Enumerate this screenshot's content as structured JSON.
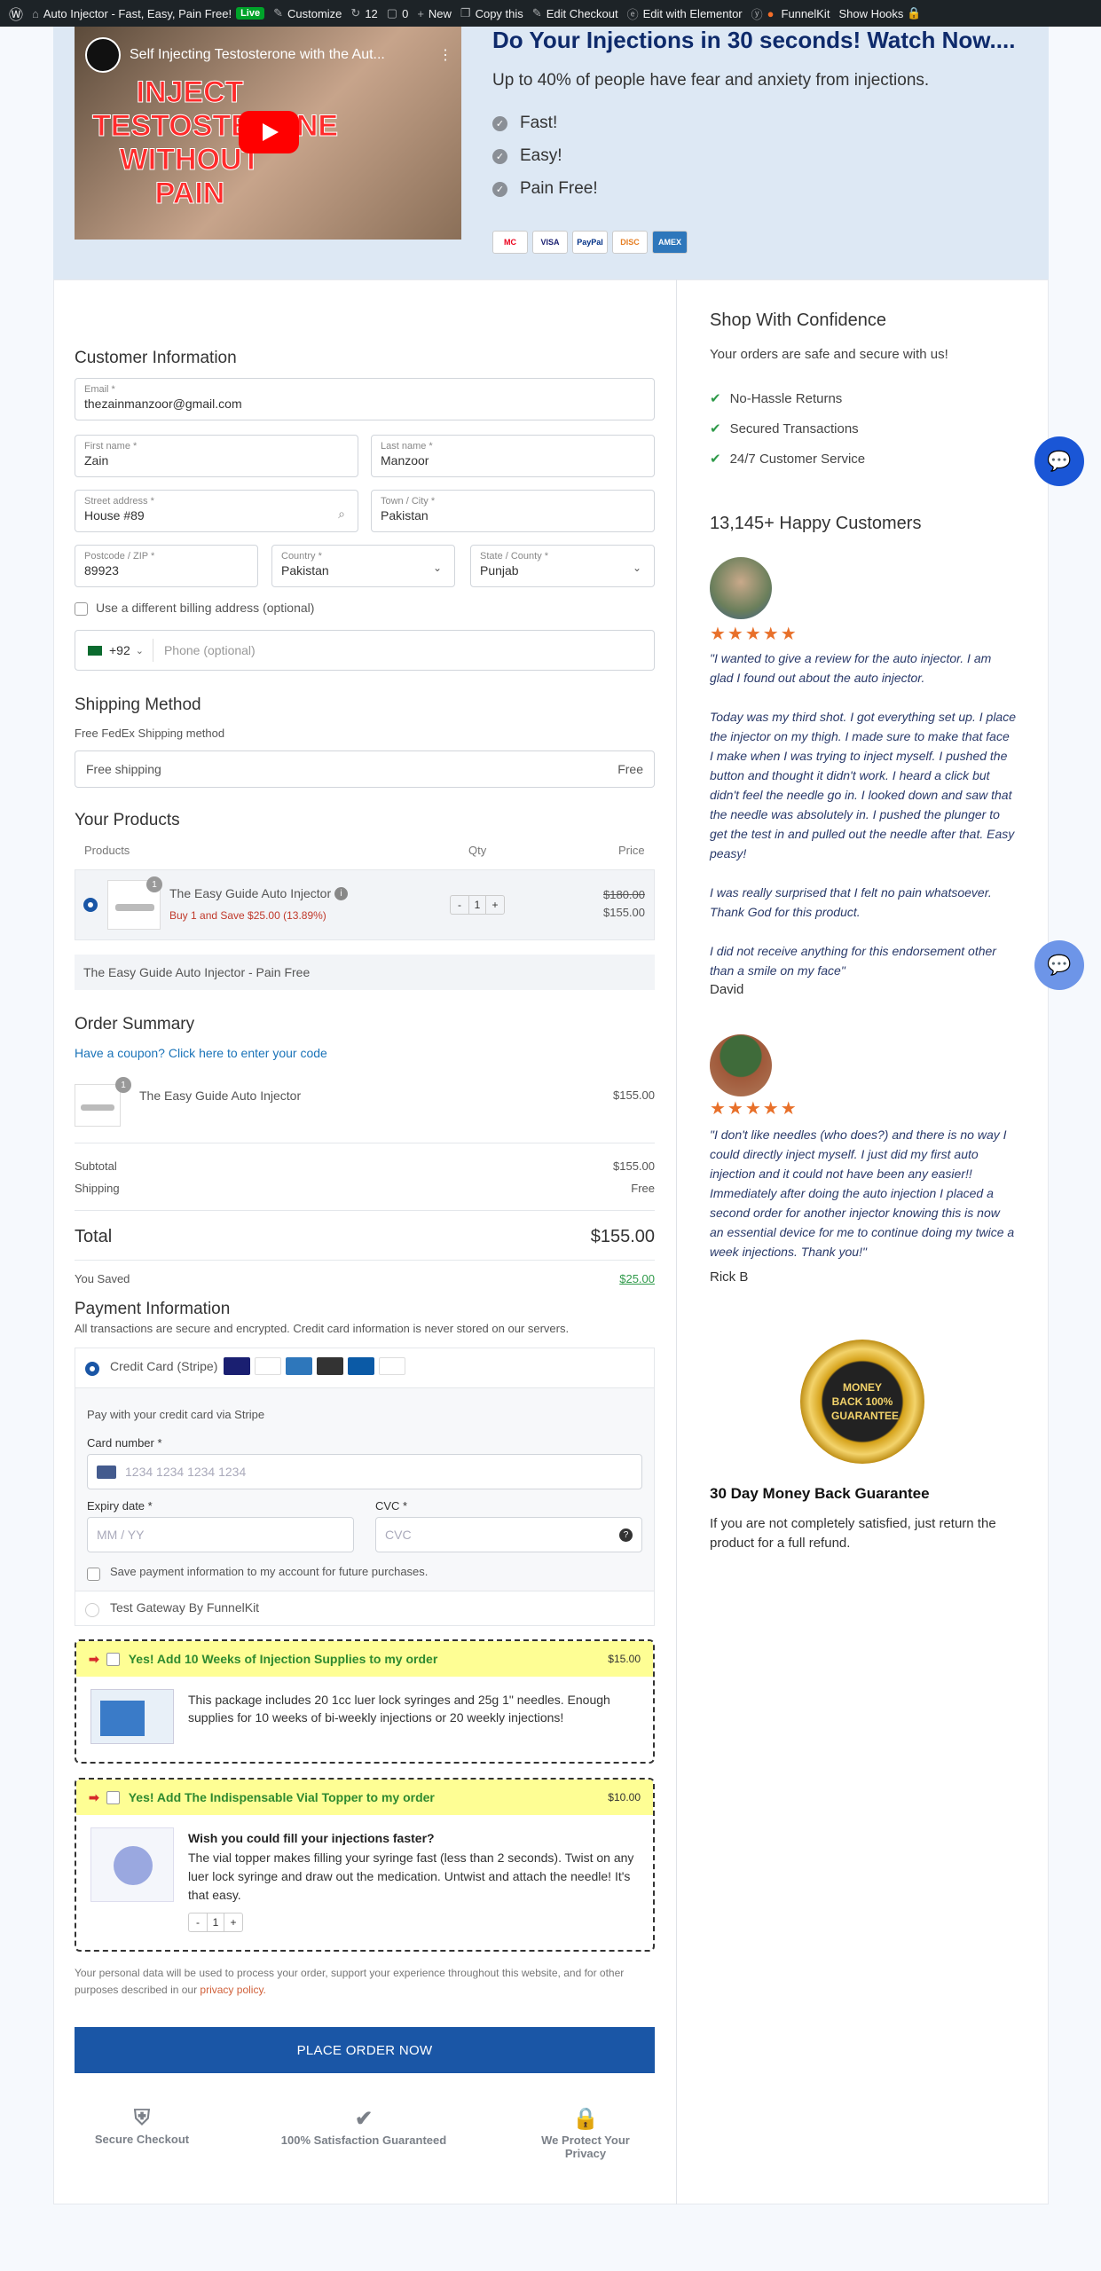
{
  "admin_bar": {
    "site": "Auto Injector - Fast, Easy, Pain Free!",
    "live": "Live",
    "customize": "Customize",
    "updates": "12",
    "comments": "0",
    "new": "New",
    "copy": "Copy this",
    "edit_checkout": "Edit Checkout",
    "elementor": "Edit with Elementor",
    "funnelkit": "FunnelKit",
    "show_hooks": "Show Hooks"
  },
  "hero": {
    "video_title": "Self Injecting Testosterone with the Aut...",
    "video_text": "INJECT TESTOSTERONE WITHOUT PAIN",
    "headline": "Do Your Injections in 30 seconds! Watch Now....",
    "subtitle": "Up to 40% of people have fear and anxiety from injections.",
    "benefits": [
      "Fast!",
      "Easy!",
      "Pain Free!"
    ],
    "cards": [
      "MC",
      "VISA",
      "PayPal",
      "DISC",
      "AMEX"
    ]
  },
  "customer": {
    "title": "Customer Information",
    "email_label": "Email *",
    "email": "thezainmanzoor@gmail.com",
    "first_label": "First name *",
    "first": "Zain",
    "last_label": "Last name *",
    "last": "Manzoor",
    "street_label": "Street address *",
    "street": "House #89",
    "city_label": "Town / City *",
    "city": "Pakistan",
    "zip_label": "Postcode / ZIP *",
    "zip": "89923",
    "country_label": "Country *",
    "country": "Pakistan",
    "state_label": "State / County *",
    "state": "Punjab",
    "billing_label": "Use a different billing address (optional)",
    "phone_code": "+92",
    "phone_placeholder": "Phone (optional)"
  },
  "shipping": {
    "title": "Shipping Method",
    "subtitle": "Free FedEx Shipping method",
    "option": "Free shipping",
    "price": "Free"
  },
  "products": {
    "title": "Your Products",
    "col_products": "Products",
    "col_qty": "Qty",
    "col_price": "Price",
    "name": "The Easy Guide Auto Injector",
    "badge": "1",
    "offer": "Buy 1 and Save $25.00 (13.89%)",
    "qty": "1",
    "old_price": "$180.00",
    "price": "$155.00",
    "description": "The Easy Guide Auto Injector - Pain Free"
  },
  "summary": {
    "title": "Order Summary",
    "coupon": "Have a coupon? Click here to enter your code",
    "item": "The Easy Guide Auto Injector",
    "item_price": "$155.00",
    "badge": "1",
    "subtotal_label": "Subtotal",
    "subtotal": "$155.00",
    "shipping_label": "Shipping",
    "shipping": "Free",
    "total_label": "Total",
    "total": "$155.00",
    "saved_label": "You Saved",
    "saved": "$25.00"
  },
  "payment": {
    "title": "Payment Information",
    "note": "All transactions are secure and encrypted. Credit card information is never stored on our servers.",
    "stripe_label": "Credit Card (Stripe)",
    "stripe_desc": "Pay with your credit card via Stripe",
    "card_label": "Card number *",
    "card_placeholder": "1234 1234 1234 1234",
    "exp_label": "Expiry date *",
    "exp_placeholder": "MM / YY",
    "cvc_label": "CVC *",
    "cvc_placeholder": "CVC",
    "save_label": "Save payment information to my account for future purchases.",
    "test_gateway": "Test Gateway By FunnelKit"
  },
  "upsells": [
    {
      "title": "Yes! Add 10 Weeks of Injection Supplies to my order",
      "price": "$15.00",
      "desc": "This package includes 20 1cc luer lock syringes and 25g 1\" needles. Enough supplies for 10 weeks of bi-weekly injections or 20 weekly injections!"
    },
    {
      "title": "Yes! Add The Indispensable Vial Topper to my order",
      "price": "$10.00",
      "heading": "Wish you could fill your injections faster?",
      "desc": "The vial topper makes filling your syringe fast (less than 2 seconds). Twist on any luer lock syringe and draw out the medication. Untwist and attach the needle! It's that easy.",
      "qty": "1"
    }
  ],
  "privacy": {
    "text": "Your personal data will be used to process your order, support your experience throughout this website, and for other purposes described in our ",
    "link": "privacy policy."
  },
  "place_order": "PLACE ORDER NOW",
  "trust": [
    "Secure Checkout",
    "100% Satisfaction Guaranteed",
    "We Protect Your Privacy"
  ],
  "sidebar": {
    "confidence_title": "Shop With Confidence",
    "confidence_sub": "Your orders are safe and secure with us!",
    "points": [
      "No-Hassle Returns",
      "Secured Transactions",
      "24/7 Customer Service"
    ],
    "happy": "13,145+ Happy Customers",
    "reviews": [
      {
        "stars": "★★★★★",
        "p1": "\"I wanted to give a review for the auto injector. I am glad I found out about the auto injector.",
        "p2": "Today was my third shot. I got everything set up. I place the injector on my thigh. I made sure to make that face I make when I was trying to inject myself. I pushed the button and thought it didn't work. I heard a click but didn't feel the needle go in. I looked down and saw that the needle was absolutely in. I pushed the plunger to get the test in and pulled out the needle after that. Easy peasy!",
        "p3": "I was really surprised that I felt no pain whatsoever. Thank God for this product.",
        "p4": "I did not receive anything for this endorsement other than a smile on my face\"",
        "author": "David"
      },
      {
        "stars": "★★★★★",
        "p1": "\"I don't like needles (who does?) and there is no way I could directly inject myself. I just did my first auto injection and it could not have been any easier!! Immediately after doing the auto injection I placed a second order for another injector knowing this is now an essential device for me to continue doing my twice a week injections. Thank you!\"",
        "author": "Rick B"
      }
    ],
    "seal_text": "MONEY BACK 100% GUARANTEE",
    "guarantee_title": "30 Day Money Back Guarantee",
    "guarantee_text": "If you are not completely satisfied, just return the product for a full refund."
  }
}
